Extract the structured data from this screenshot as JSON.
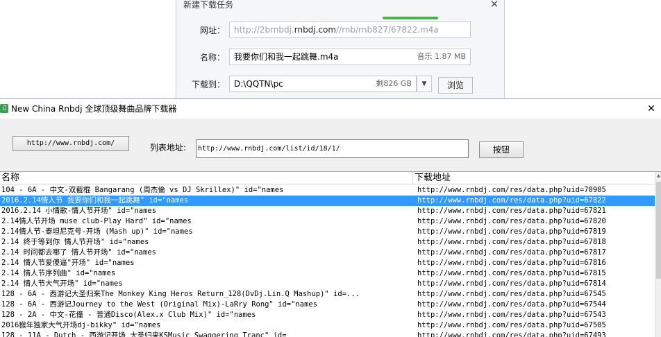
{
  "download_dialog": {
    "title": "新建下载任务",
    "close_glyph": "✕",
    "url_label": "网址：",
    "url_prefix": "http://2brnbdj.",
    "url_domain": "rnbdj.com",
    "url_suffix": "//rnb/rnb827/67822.m4a",
    "name_label": "名称：",
    "name_value": "我要你们和我一起跳舞.m4a",
    "name_meta": "音乐 1.87 MB",
    "dest_label": "下载到：",
    "dest_value": "D:\\QQTN\\pc",
    "dest_meta": "剩826 GB",
    "dest_dropdown": "▼",
    "browse_label": "浏览"
  },
  "window": {
    "title": "New China Rnbdj 全球顶级舞曲品牌下载器",
    "close_glyph": "✕"
  },
  "toolbar": {
    "url_button": "http://www.rnbdj.com/",
    "list_label": "列表地址:",
    "list_value": "http://www.rnbdj.com/list/id/18/1/",
    "go_button": "按钮"
  },
  "table": {
    "columns": [
      "名称",
      "下载地址"
    ],
    "rows": [
      {
        "name": "104 - 6A - 中文-双截棍 Bangarang (周杰倫 vs DJ Skrillex)\" id=\"names",
        "url": "http://www.rnbdj.com/res/data.php?uid=70905"
      },
      {
        "name": "2016.2.14情人节 我要你们和我一起跳舞\" id=\"names",
        "url": "http://www.rnbdj.com/res/data.php?uid=67822"
      },
      {
        "name": "2016.2.14 小情歌-情人节开场\" id=\"names",
        "url": "http://www.rnbdj.com/res/data.php?uid=67821"
      },
      {
        "name": "2.14情人节开场 muse club-Play Hard\" id=\"names",
        "url": "http://www.rnbdj.com/res/data.php?uid=67820"
      },
      {
        "name": "2.14情人节-泰坦尼克号-开场 (Mash up)\" id=\"names",
        "url": "http://www.rnbdj.com/res/data.php?uid=67819"
      },
      {
        "name": "2.14 终于等到你 情人节开场\" id=\"names",
        "url": "http://www.rnbdj.com/res/data.php?uid=67818"
      },
      {
        "name": "2.14 时间都去哪了 情人节开场\" id=\"names",
        "url": "http://www.rnbdj.com/res/data.php?uid=67817"
      },
      {
        "name": "2.14 情人节爱傻逼\"开场\" id=\"names",
        "url": "http://www.rnbdj.com/res/data.php?uid=67816"
      },
      {
        "name": "2.14 情人节序列曲\" id=\"names",
        "url": "http://www.rnbdj.com/res/data.php?uid=67815"
      },
      {
        "name": "2.14 情人节大气开场\" id=\"names",
        "url": "http://www.rnbdj.com/res/data.php?uid=67814"
      },
      {
        "name": "128 - 6A - 西游记大圣归来The Monkey King Heros Return_128(DvDj.Lin.Q Mashup)\" id=...",
        "url": "http://www.rnbdj.com/res/data.php?uid=67545"
      },
      {
        "name": "128 - 6A - 西游记Journey to the West (Original Mix)-LaRry Rong\" id=\"names",
        "url": "http://www.rnbdj.com/res/data.php?uid=67544"
      },
      {
        "name": "128 - 2A - 中文-花僮 - 普通Disco(Alex.x Club Mix)\" id=\"names",
        "url": "http://www.rnbdj.com/res/data.php?uid=67543"
      },
      {
        "name": "2016猴年独家大气开场dj-bikky\" id=\"names",
        "url": "http://www.rnbdj.com/res/data.php?uid=67505"
      },
      {
        "name": "128 - 11A - Dutch - 西游记开场 大圣归来KSMusic Swaggering Tranc\" id=",
        "url": "http://www.rnbdj.com/res/data.php?uid=67493"
      }
    ],
    "selected_index": 1
  },
  "scrollbar": {
    "up_glyph": "▲"
  },
  "colors": {
    "selection": "#3399ff",
    "app_icon": "#3f9e4f",
    "dialog_accent": "#49b04b"
  }
}
